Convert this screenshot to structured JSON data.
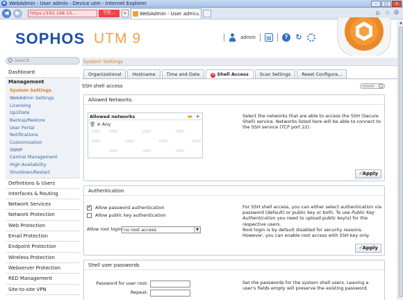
{
  "browser": {
    "window_title": "WebAdmin - User admin - Device utm - Internet Explorer",
    "url": "https://192.168.10....",
    "cert_label": "인증...",
    "tab_title": "WebAdmin - User admi...",
    "tab_close": "×"
  },
  "header": {
    "logo": "SOPHOS",
    "product": "UTM 9",
    "username": "admin"
  },
  "sidebar": {
    "search_placeholder": "search",
    "items_top": [
      "Dashboard"
    ],
    "group_title": "Management",
    "subitems": [
      "System Settings",
      "WebAdmin Settings",
      "Licensing",
      "Up2Date",
      "Backup/Restore",
      "User Portal",
      "Notifications",
      "Customization",
      "SNMP",
      "Central Management",
      "High Availability",
      "Shutdown/Restart"
    ],
    "active_subitem": "System Settings",
    "items_bottom": [
      "Definitions & Users",
      "Interfaces & Routing",
      "Network Services",
      "Network Protection",
      "Web Protection",
      "Email Protection",
      "Endpoint Protection",
      "Wireless Protection",
      "Webserver Protection",
      "RED Management",
      "Site-to-site VPN"
    ]
  },
  "main": {
    "section_title": "System Settings",
    "tabs": [
      "Organizational",
      "Hostname",
      "Time and Date",
      "Shell Access",
      "Scan Settings",
      "Reset Configura..."
    ],
    "active_tab": "Shell Access",
    "ssh_label": "SSH shell access"
  },
  "allowed_networks": {
    "title": "Allowed Networks",
    "box_title": "Allowed networks",
    "entry": "Any",
    "dnd": "DND",
    "description": "Select the networks that are able to access the SSH (Secure Shell) service. Networks listed here will be able to connect to the SSH service (TCP port 22).",
    "apply": "Apply"
  },
  "authentication": {
    "title": "Authentication",
    "opt_password": "Allow password authentication",
    "opt_password_checked": true,
    "opt_pubkey": "Allow public key authentication",
    "opt_pubkey_checked": false,
    "root_login_label": "Allow root login:",
    "root_login_value": "no root access",
    "desc1_a": "For SSH shell access, you can either select authentication via password (default) or public key or both. To use ",
    "desc1_em": "Public Key Authentication",
    "desc1_b": " you need to upload public key(s) for the respective users.",
    "desc2": "Root login is by default disabled for security reasons. However, you can enable root access with SSH key only.",
    "apply": "Apply"
  },
  "passwords": {
    "title": "Shell user passwords",
    "root_label": "Password for user root:",
    "repeat_label": "Repeat:",
    "description": "Set the passwords for the system shell users. Leaving a user's fields empty will preserve the existing password."
  },
  "colors": {
    "accent_orange": "#e07b1c",
    "brand_blue": "#1b4fa8",
    "link_blue": "#3260a8",
    "apply_green": "#3a9b2c"
  }
}
